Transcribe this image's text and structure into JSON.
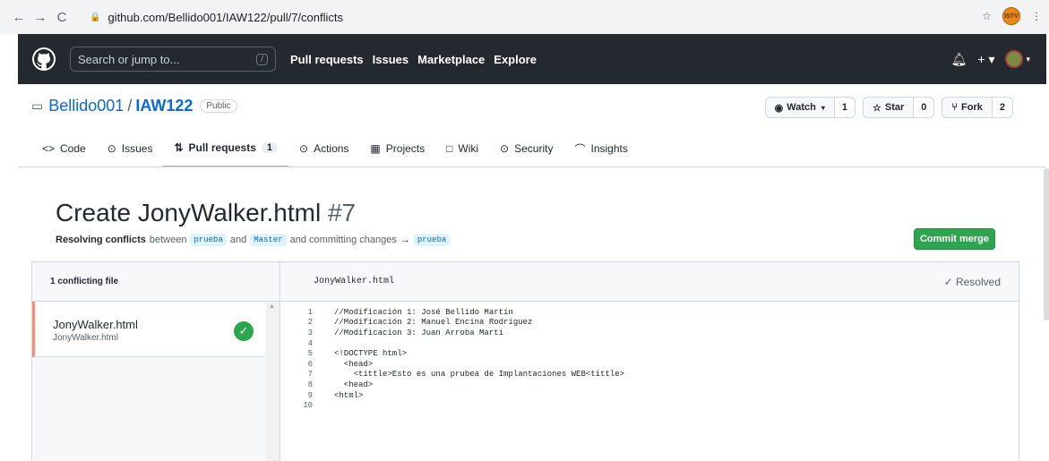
{
  "browser": {
    "url": "github.com/Bellido001/IAW122/pull/7/conflicts",
    "back_glyph": "←",
    "forward_glyph": "→",
    "reload_glyph": "C",
    "ext_label": "ISTV"
  },
  "header": {
    "search_placeholder": "Search or jump to...",
    "slash_key": "/",
    "nav": [
      "Pull requests",
      "Issues",
      "Marketplace",
      "Explore"
    ]
  },
  "repo": {
    "owner": "Bellido001",
    "separator": "/",
    "name": "IAW122",
    "visibility": "Public",
    "watch_label": "Watch",
    "watch_count": "1",
    "star_label": "Star",
    "star_count": "0",
    "fork_label": "Fork",
    "fork_count": "2"
  },
  "tabs": [
    {
      "icon": "<>",
      "label": "Code"
    },
    {
      "icon": "⊙",
      "label": "Issues"
    },
    {
      "icon": "⇅",
      "label": "Pull requests",
      "count": "1"
    },
    {
      "icon": "⊙",
      "label": "Actions"
    },
    {
      "icon": "▦",
      "label": "Projects"
    },
    {
      "icon": "□",
      "label": "Wiki"
    },
    {
      "icon": "⊙",
      "label": "Security"
    },
    {
      "icon": "⌒",
      "label": "Insights"
    }
  ],
  "pr": {
    "title": "Create JonyWalker.html",
    "number": "#7",
    "resolving": "Resolving conflicts",
    "between": "between",
    "branch_from": "prueba",
    "and": "and",
    "branch_to": "Master",
    "committing": "and committing changes",
    "arrow": "→",
    "branch_target": "prueba",
    "commit_button": "Commit merge"
  },
  "sidebar": {
    "heading": "1 conflicting file",
    "file_name": "JonyWalker.html",
    "file_path": "JonyWalker.html"
  },
  "editor": {
    "file_name": "JonyWalker.html",
    "status": "Resolved",
    "lines": [
      {
        "n": "1",
        "text": "//Modificación 1: José Bellido Martín"
      },
      {
        "n": "2",
        "text": "//Modificación 2: Manuel Encina Rodríguez"
      },
      {
        "n": "3",
        "text": "//Modificacion 3: Juan Arroba Martí"
      },
      {
        "n": "4",
        "text": ""
      },
      {
        "n": "5",
        "text": "<!DOCTYPE html>"
      },
      {
        "n": "6",
        "text": "  <head>"
      },
      {
        "n": "7",
        "text": "    <tittle>Esto es una prubea de Implantaciones WEB<tittle>"
      },
      {
        "n": "8",
        "text": "  <head>"
      },
      {
        "n": "9",
        "text": "<html>"
      },
      {
        "n": "10",
        "text": ""
      }
    ]
  }
}
